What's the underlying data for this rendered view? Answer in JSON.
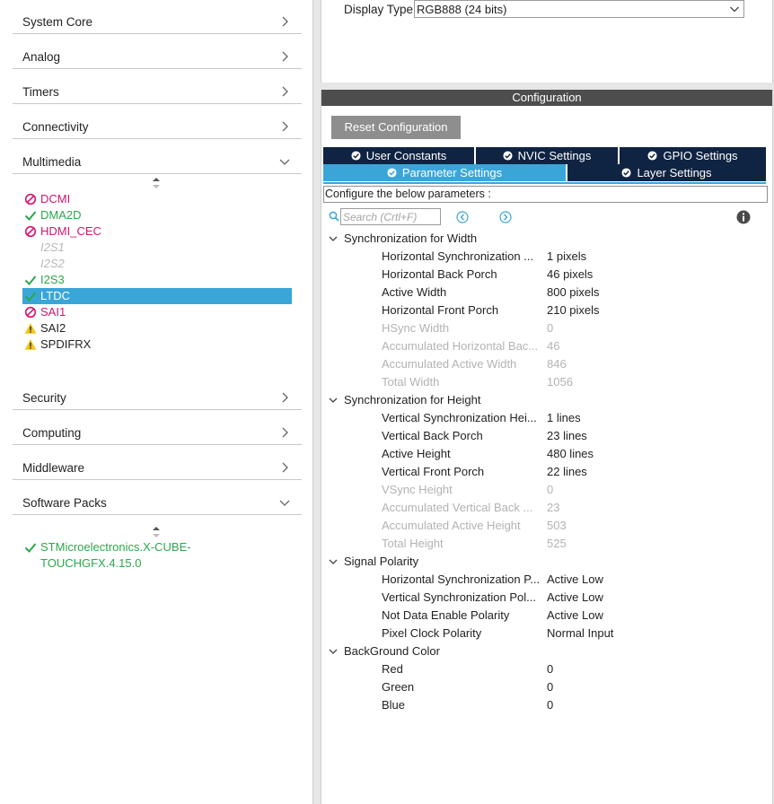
{
  "sidebar": {
    "categories_top": [
      {
        "label": "System Core",
        "expanded": false
      },
      {
        "label": "Analog",
        "expanded": false
      },
      {
        "label": "Timers",
        "expanded": false
      },
      {
        "label": "Connectivity",
        "expanded": false
      },
      {
        "label": "Multimedia",
        "expanded": true
      }
    ],
    "multimedia_items": [
      {
        "label": "DCMI",
        "status": "conflict",
        "icon": "no-entry-icon"
      },
      {
        "label": "DMA2D",
        "status": "ok",
        "icon": "check-icon"
      },
      {
        "label": "HDMI_CEC",
        "status": "conflict",
        "icon": "no-entry-icon"
      },
      {
        "label": "I2S1",
        "status": "disabled",
        "icon": ""
      },
      {
        "label": "I2S2",
        "status": "disabled",
        "icon": ""
      },
      {
        "label": "I2S3",
        "status": "ok",
        "icon": "check-icon"
      },
      {
        "label": "LTDC",
        "status": "ok",
        "icon": "check-icon",
        "selected": true
      },
      {
        "label": "SAI1",
        "status": "conflict",
        "icon": "no-entry-icon"
      },
      {
        "label": "SAI2",
        "status": "warning",
        "icon": "warning-icon"
      },
      {
        "label": "SPDIFRX",
        "status": "warning",
        "icon": "warning-icon"
      }
    ],
    "categories_bottom": [
      {
        "label": "Security",
        "expanded": false
      },
      {
        "label": "Computing",
        "expanded": false
      },
      {
        "label": "Middleware",
        "expanded": false
      },
      {
        "label": "Software Packs",
        "expanded": true
      }
    ],
    "software_pack_items": [
      {
        "label": "STMicroelectronics.X-CUBE-TOUCHGFX.4.15.0",
        "status": "ok",
        "icon": "check-icon"
      }
    ]
  },
  "display": {
    "label": "Display Type",
    "value": "RGB888 (24 bits)"
  },
  "configuration": {
    "header": "Configuration",
    "reset_label": "Reset Configuration",
    "tabs_row1": [
      "User Constants",
      "NVIC Settings",
      "GPIO Settings"
    ],
    "tabs_row2": [
      "Parameter Settings",
      "Layer Settings"
    ],
    "active_tab": "Parameter Settings",
    "hint": "Configure the below parameters :",
    "search_placeholder": "Search (Crtl+F)",
    "groups": [
      {
        "name": "Synchronization for Width",
        "params": [
          {
            "name": "Horizontal Synchronization ...",
            "value": "1 pixels",
            "editable": true
          },
          {
            "name": "Horizontal Back Porch",
            "value": "46 pixels",
            "editable": true
          },
          {
            "name": "Active Width",
            "value": "800 pixels",
            "editable": true
          },
          {
            "name": "Horizontal Front Porch",
            "value": "210 pixels",
            "editable": true
          },
          {
            "name": "HSync Width",
            "value": "0",
            "editable": false
          },
          {
            "name": "Accumulated Horizontal Bac...",
            "value": "46",
            "editable": false
          },
          {
            "name": "Accumulated Active Width",
            "value": "846",
            "editable": false
          },
          {
            "name": "Total Width",
            "value": "1056",
            "editable": false
          }
        ]
      },
      {
        "name": "Synchronization for Height",
        "params": [
          {
            "name": "Vertical Synchronization Hei...",
            "value": "1 lines",
            "editable": true
          },
          {
            "name": "Vertical Back Porch",
            "value": "23 lines",
            "editable": true
          },
          {
            "name": "Active Height",
            "value": "480 lines",
            "editable": true
          },
          {
            "name": "Vertical Front Porch",
            "value": "22 lines",
            "editable": true
          },
          {
            "name": "VSync Height",
            "value": "0",
            "editable": false
          },
          {
            "name": "Accumulated Vertical Back ...",
            "value": "23",
            "editable": false
          },
          {
            "name": "Accumulated Active Height",
            "value": "503",
            "editable": false
          },
          {
            "name": "Total Height",
            "value": "525",
            "editable": false
          }
        ]
      },
      {
        "name": "Signal Polarity",
        "params": [
          {
            "name": "Horizontal Synchronization P...",
            "value": "Active Low",
            "editable": true
          },
          {
            "name": "Vertical Synchronization Pol...",
            "value": "Active Low",
            "editable": true
          },
          {
            "name": "Not Data Enable Polarity",
            "value": "Active Low",
            "editable": true
          },
          {
            "name": "Pixel Clock Polarity",
            "value": "Normal Input",
            "editable": true
          }
        ]
      },
      {
        "name": "BackGround Color",
        "params": [
          {
            "name": "Red",
            "value": "0",
            "editable": true
          },
          {
            "name": "Green",
            "value": "0",
            "editable": true
          },
          {
            "name": "Blue",
            "value": "0",
            "editable": true
          }
        ]
      }
    ]
  },
  "colors": {
    "accent": "#3aa6d8",
    "tab_dark": "#0f2342",
    "ok": "#2aa84a",
    "conflict": "#d6136f",
    "warning": "#f3c316",
    "header_bg": "#4d4d4d",
    "button_bg": "#8e8e8e"
  }
}
